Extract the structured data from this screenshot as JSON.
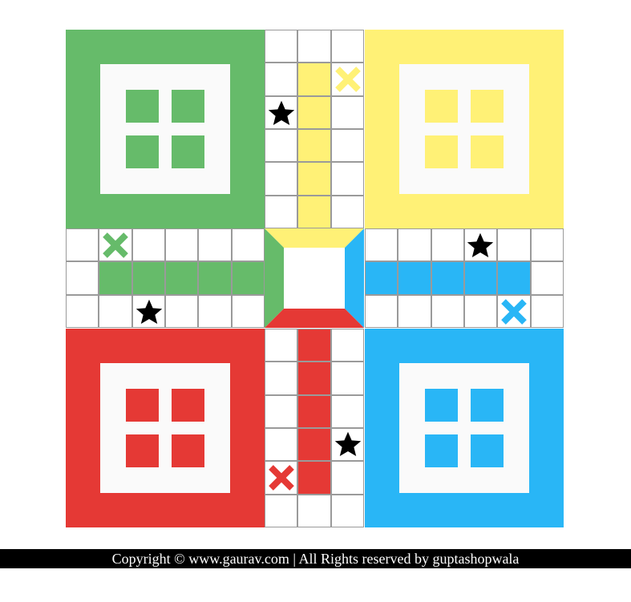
{
  "colors": {
    "green": "#66bb6a",
    "yellow": "#fff176",
    "blue": "#29b6f6",
    "red": "#e53935",
    "white": "#fafafa",
    "grid_line": "#9a9a9a",
    "star": "#000000"
  },
  "homes": [
    {
      "name": "green-home",
      "color": "green",
      "tokens": 4
    },
    {
      "name": "yellow-home",
      "color": "yellow",
      "tokens": 4
    },
    {
      "name": "red-home",
      "color": "red",
      "tokens": 4
    },
    {
      "name": "blue-home",
      "color": "blue",
      "tokens": 4
    }
  ],
  "lanes": [
    {
      "name": "yellow-home-column",
      "color": "yellow"
    },
    {
      "name": "green-home-column",
      "color": "green"
    },
    {
      "name": "blue-home-column",
      "color": "blue"
    },
    {
      "name": "red-home-column",
      "color": "red"
    }
  ],
  "start_markers": [
    {
      "name": "yellow-start-cross",
      "color": "yellow",
      "icon": "cross-icon"
    },
    {
      "name": "green-start-cross",
      "color": "green",
      "icon": "cross-icon"
    },
    {
      "name": "blue-start-cross",
      "color": "blue",
      "icon": "cross-icon"
    },
    {
      "name": "red-start-cross",
      "color": "red",
      "icon": "cross-icon"
    }
  ],
  "safe_markers": [
    {
      "name": "safe-star-top",
      "icon": "star-icon"
    },
    {
      "name": "safe-star-left",
      "icon": "star-icon"
    },
    {
      "name": "safe-star-right",
      "icon": "star-icon"
    },
    {
      "name": "safe-star-bottom",
      "icon": "star-icon"
    }
  ],
  "footer": {
    "text": "Copyright © www.gaurav.com | All Rights reserved by guptashopwala"
  }
}
